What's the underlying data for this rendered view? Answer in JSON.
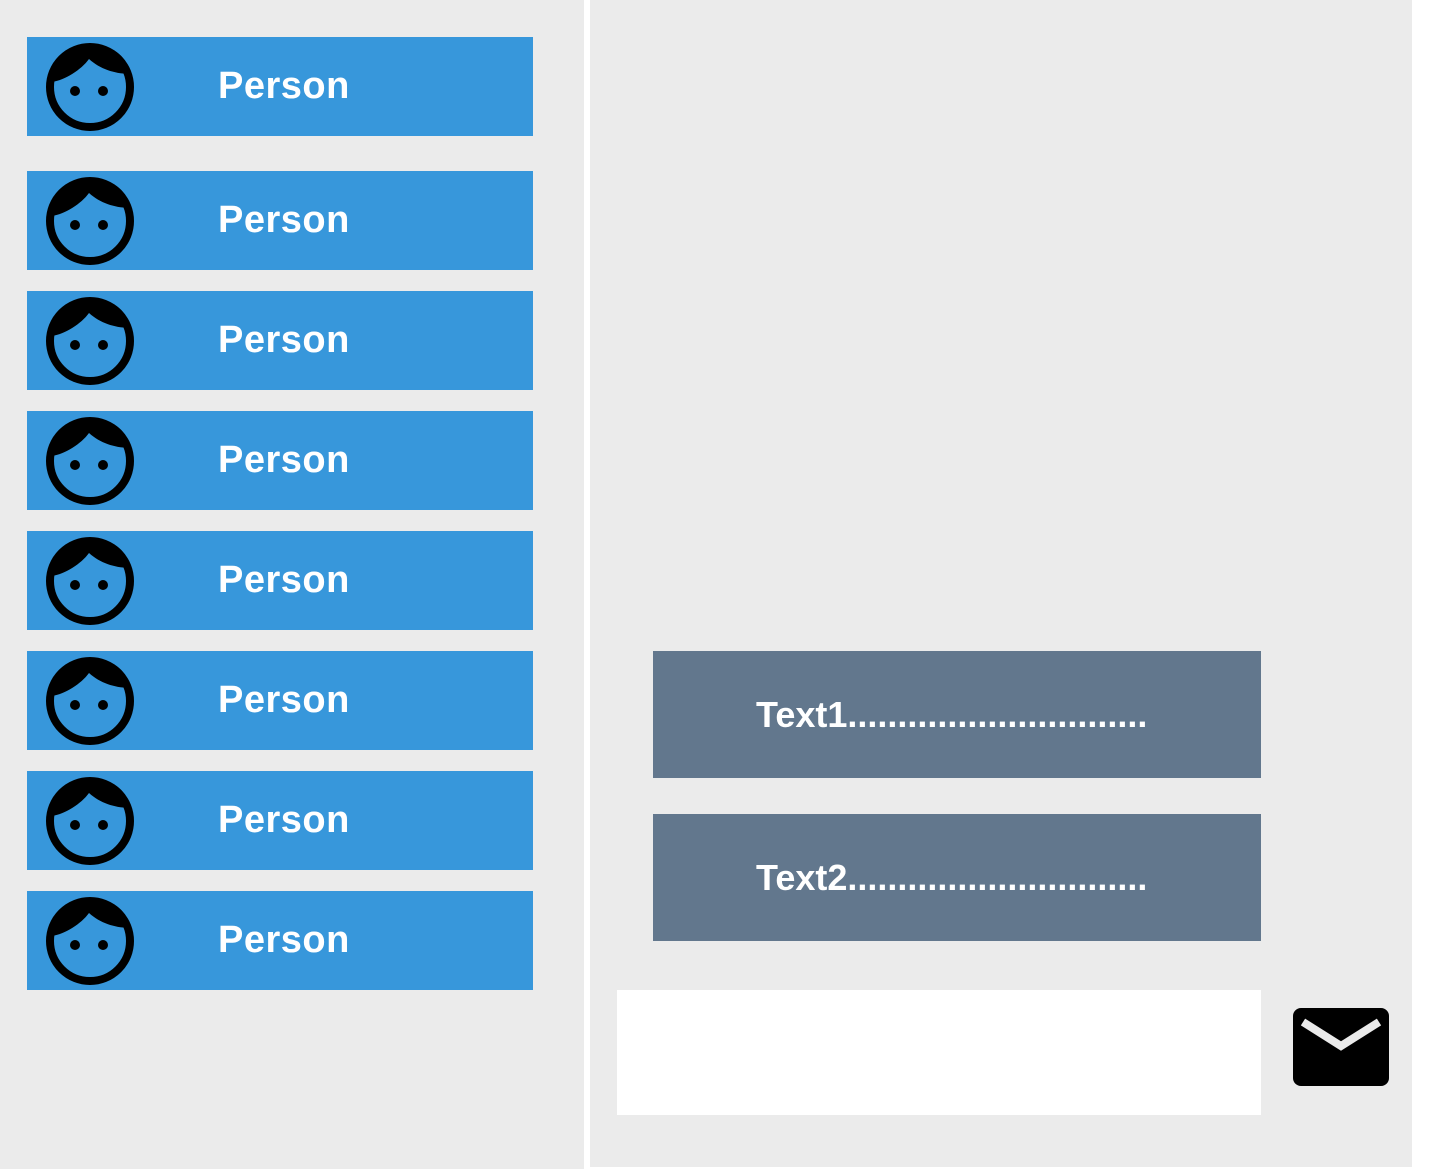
{
  "contacts": [
    {
      "label": "Person",
      "icon": "face-icon"
    },
    {
      "label": "Person",
      "icon": "face-icon"
    },
    {
      "label": "Person",
      "icon": "face-icon"
    },
    {
      "label": "Person",
      "icon": "face-icon"
    },
    {
      "label": "Person",
      "icon": "face-icon"
    },
    {
      "label": "Person",
      "icon": "face-icon"
    },
    {
      "label": "Person",
      "icon": "face-icon"
    },
    {
      "label": "Person",
      "icon": "face-icon"
    }
  ],
  "messages": [
    {
      "text": "Text1.............................."
    },
    {
      "text": "Text2.............................."
    }
  ],
  "compose": {
    "value": "",
    "send_icon": "mail-icon"
  },
  "colors": {
    "panel_bg": "#ebebeb",
    "contact_bg": "#3797db",
    "message_bg": "#62778d",
    "text": "#ffffff"
  }
}
